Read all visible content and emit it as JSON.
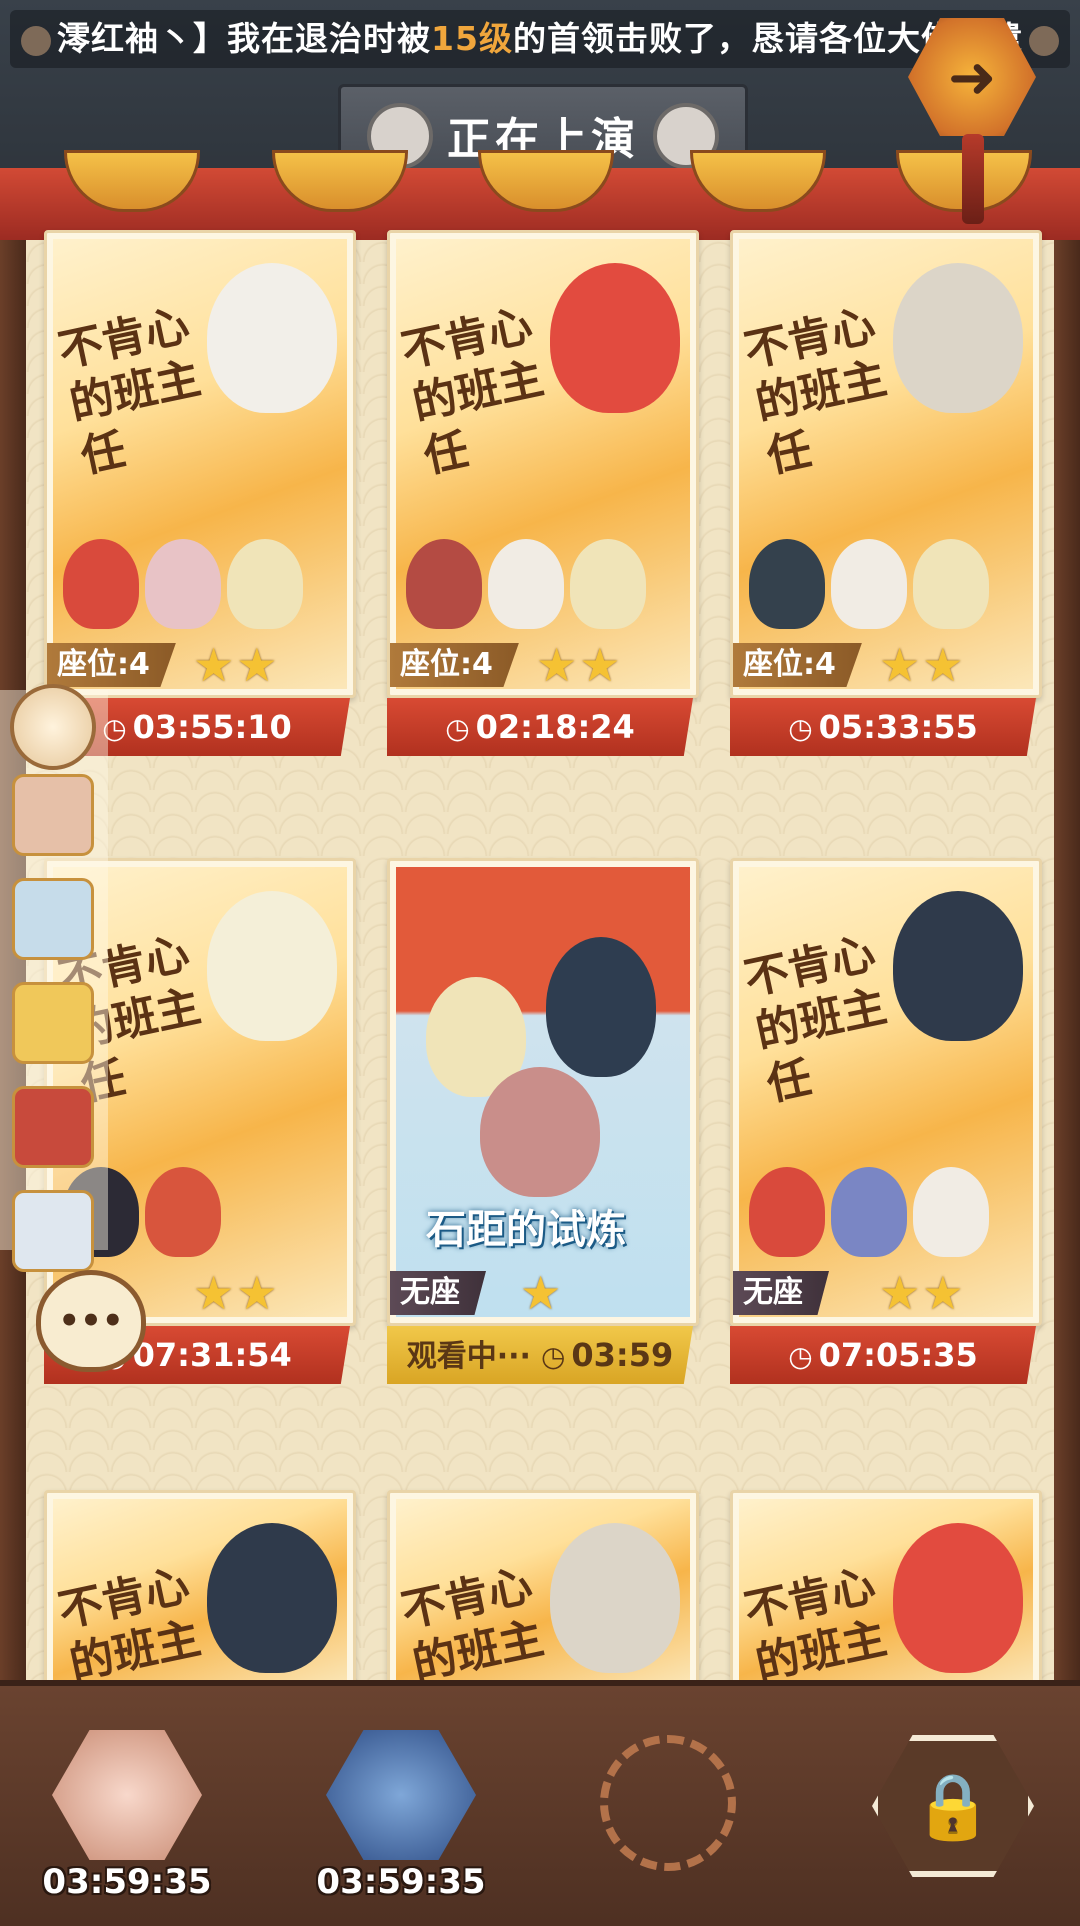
{
  "header": {
    "ticker_prefix": "澪红袖丶】我在退治时被",
    "ticker_highlight": "15级",
    "ticker_suffix": "的首领击败了，恳请各位大佬派遣",
    "title": "正在上演"
  },
  "cards": [
    {
      "art_title": "不肯心的班主任",
      "seat": "座位:4",
      "stars": 2,
      "timer": "03:55:10"
    },
    {
      "art_title": "不肯心的班主任",
      "seat": "座位:4",
      "stars": 2,
      "timer": "02:18:24"
    },
    {
      "art_title": "不肯心的班主任",
      "seat": "座位:4",
      "stars": 2,
      "timer": "05:33:55"
    },
    {
      "art_title": "不肯心的班主任",
      "seat": "",
      "stars": 2,
      "timer": "07:31:54"
    },
    {
      "art_title": "石距的试炼",
      "seat": "无座",
      "stars": 1,
      "timer": "03:59",
      "watching_label": "观看中···"
    },
    {
      "art_title": "不肯心的班主任",
      "seat": "无座",
      "stars": 2,
      "timer": "07:05:35"
    },
    {
      "art_title": "不肯心的班主任"
    },
    {
      "art_title": "不肯心的班主任"
    },
    {
      "art_title": "不肯心的班主任"
    }
  ],
  "bottom": {
    "slot1_time": "03:59:35",
    "slot2_time": "03:59:35"
  },
  "menu_label": "•••",
  "colors": {
    "accent_red": "#d84a33",
    "gold": "#f1c84a",
    "board": "#f1e4c4"
  },
  "icons": [
    "exit-icon",
    "clock-icon",
    "star-icon",
    "lock-icon",
    "menu-icon"
  ]
}
